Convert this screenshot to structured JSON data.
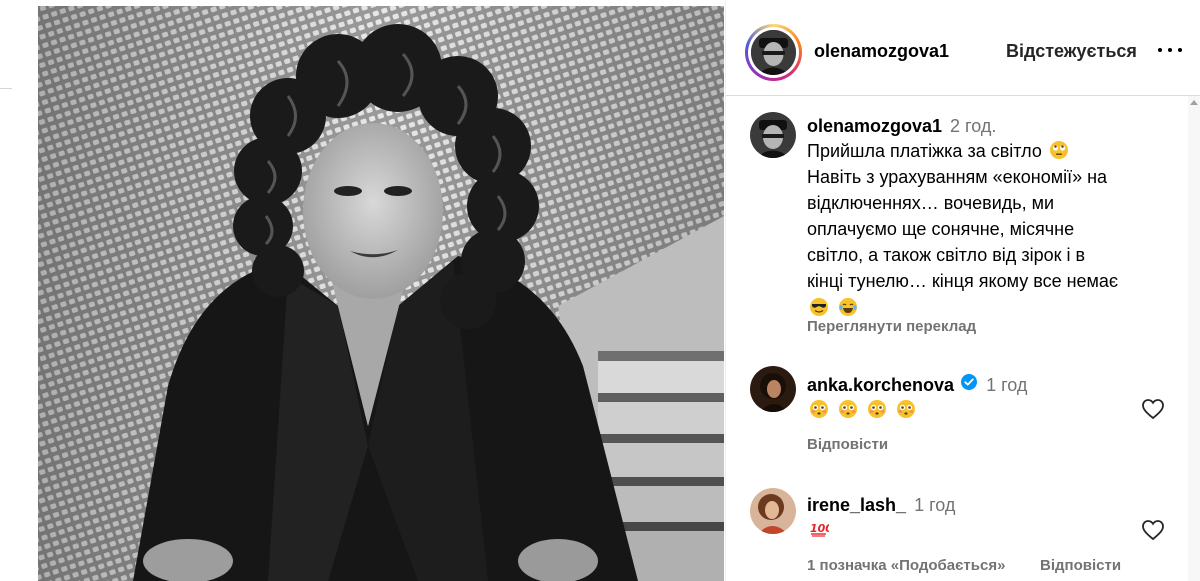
{
  "post": {
    "author": "olenamozgova1",
    "follow_status": "Відстежується"
  },
  "caption": {
    "username": "olenamozgova1",
    "time": "2 год.",
    "lines": [
      "Прийшла платіжка за світло",
      "Навіть з урахуванням «економії» на",
      "відключеннях… вочевидь, ми",
      "оплачуємо ще сонячне, місячне",
      "світло, а також світло від зірок і в",
      "кінці тунелю… кінця якому все немає"
    ],
    "translate_label": "Переглянути переклад"
  },
  "comments": [
    {
      "username": "anka.korchenova",
      "verified": true,
      "time": "1 год",
      "reply_label": "Відповісти"
    },
    {
      "username": "irene_lash_",
      "verified": false,
      "time": "1 год",
      "likes_label": "1 позначка «Подобається»",
      "reply_label": "Відповісти"
    }
  ],
  "icons": {
    "more": "more-options-icon",
    "heart": "heart-outline-icon",
    "verified": "verified-badge-icon",
    "eye_roll": "face-with-rolling-eyes-emoji",
    "sunglasses": "smiling-face-with-sunglasses-emoji",
    "laugh": "face-with-tears-of-joy-emoji",
    "flushed": "flushed-face-emoji",
    "hundred": "hundred-points-emoji"
  },
  "colors": {
    "text": "#000000",
    "secondary": "#737373",
    "verified": "#0095f6",
    "divider": "#dbdbdb"
  }
}
